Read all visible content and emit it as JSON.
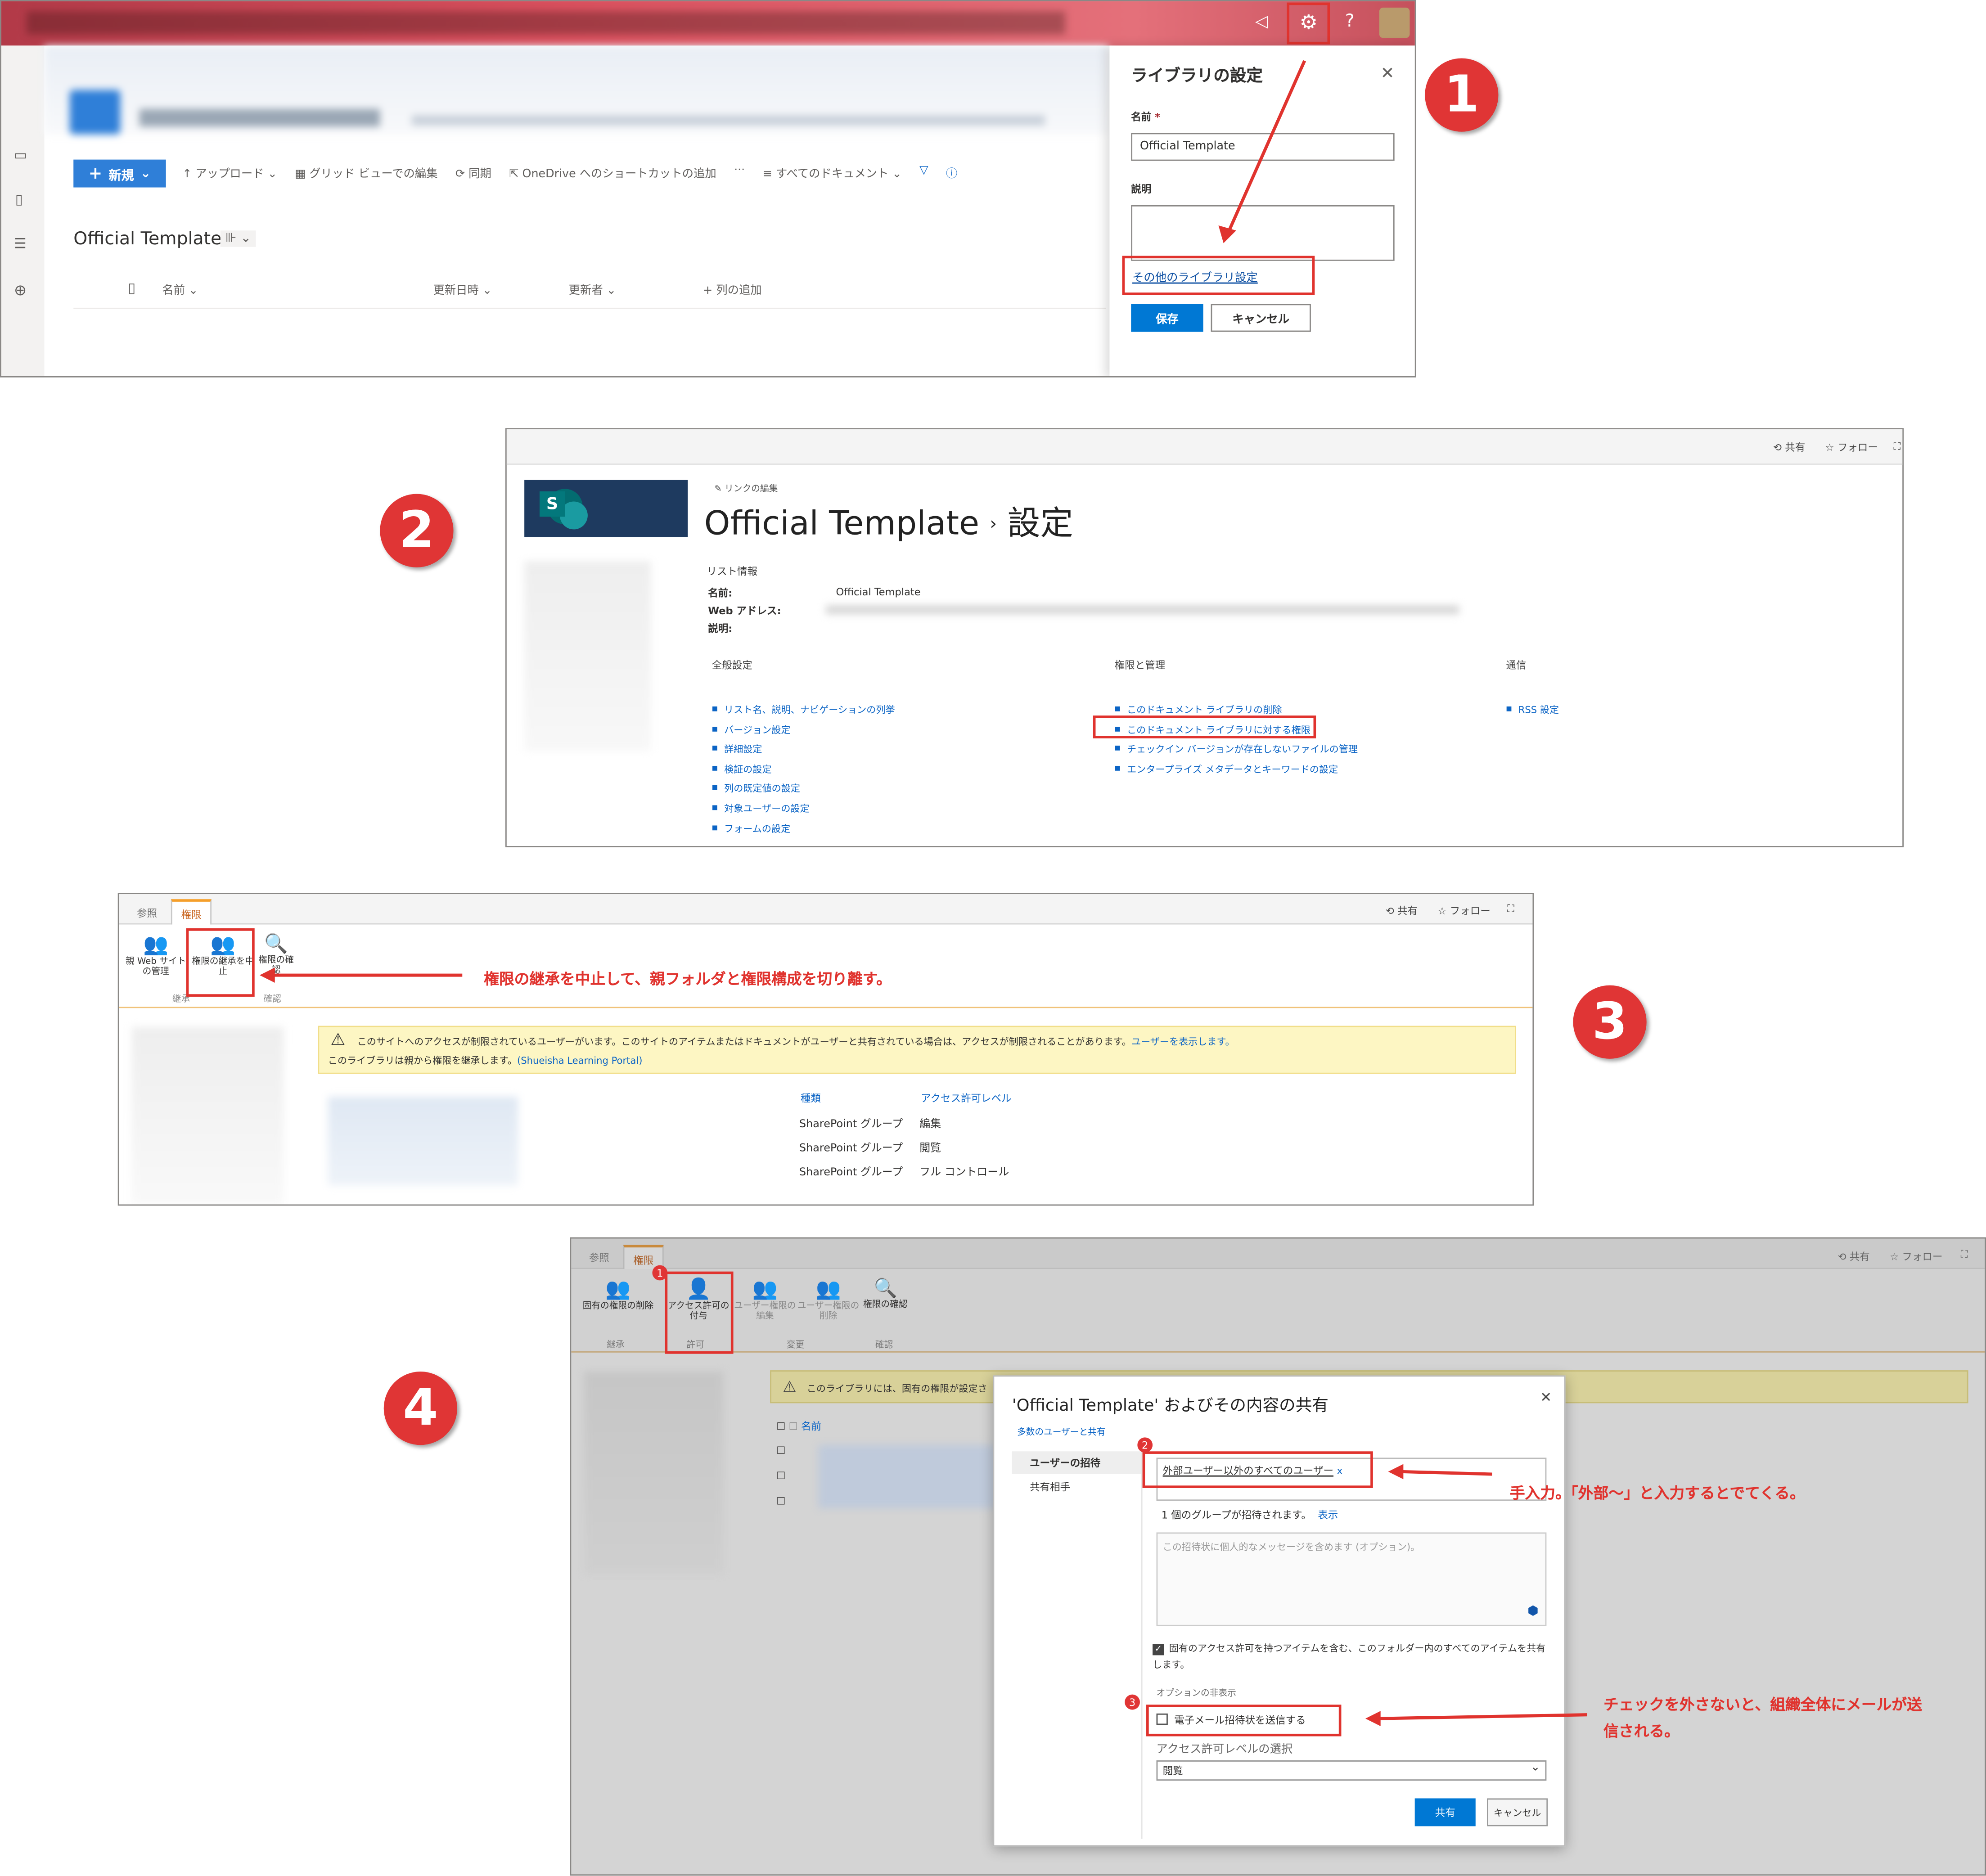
{
  "p1": {
    "commands": {
      "new": "新規",
      "upload": "アップロード",
      "grid_edit": "グリッド ビューでの編集",
      "sync": "同期",
      "onedrive": "OneDrive へのショートカットの追加",
      "more": "···",
      "all_docs": "すべてのドキュメント"
    },
    "library_title": "Official Template",
    "columns": {
      "name": "名前",
      "modified": "更新日時",
      "modified_by": "更新者",
      "add_column": "列の追加"
    },
    "settings_panel": {
      "title": "ライブラリの設定",
      "name_label": "名前",
      "required_mark": "*",
      "name_value": "Official Template",
      "desc_label": "説明",
      "more_settings_link": "その他のライブラリ設定",
      "save": "保存",
      "cancel": "キャンセル"
    }
  },
  "p2": {
    "share": "共有",
    "follow": "フォロー",
    "edit_links": "リンクの編集",
    "logo_letter": "S",
    "title": "Official Template",
    "title_sep": "›",
    "title_page": "設定",
    "list_info": "リスト情報",
    "info_name_label": "名前:",
    "info_name_value": "Official Template",
    "info_web_label": "Web アドレス:",
    "info_desc_label": "説明:",
    "col_general": "全般設定",
    "col_perm": "権限と管理",
    "col_comm": "通信",
    "general_links": [
      "リスト名、説明、ナビゲーションの列挙",
      "バージョン設定",
      "詳細設定",
      "検証の設定",
      "列の既定値の設定",
      "対象ユーザーの設定",
      "フォームの設定"
    ],
    "perm_links": [
      "このドキュメント ライブラリの削除",
      "このドキュメント ライブラリに対する権限",
      "チェックイン バージョンが存在しないファイルの管理",
      "エンタープライズ メタデータとキーワードの設定"
    ],
    "comm_links": [
      "RSS 設定"
    ]
  },
  "p3": {
    "tab_browse": "参照",
    "tab_perm": "権限",
    "share": "共有",
    "follow": "フォロー",
    "btn_parent": "親 Web サイトの管理",
    "btn_stop": "権限の継承を中止",
    "btn_check": "権限の確認",
    "group_inherit": "継承",
    "group_check": "確認",
    "note": "権限の継承を中止して、親フォルダと権限構成を切り離す。",
    "warning": "このサイトへのアクセスが制限されているユーザーがいます。このサイトのアイテムまたはドキュメントがユーザーと共有されている場合は、アクセスが制限されることがあります。",
    "warning_link": "ユーザーを表示します。",
    "inherit_text": "このライブラリは親から権限を継承します。",
    "inherit_link": "(Shueisha Learning Portal)",
    "col_type": "種類",
    "col_level": "アクセス許可レベル",
    "rows": [
      {
        "type": "SharePoint グループ",
        "level": "編集"
      },
      {
        "type": "SharePoint グループ",
        "level": "閲覧"
      },
      {
        "type": "SharePoint グループ",
        "level": "フル コントロール"
      }
    ]
  },
  "p4": {
    "tab_browse": "参照",
    "tab_perm": "権限",
    "share": "共有",
    "follow": "フォロー",
    "btn_delete_unique": "固有の権限の削除",
    "btn_grant": "アクセス許可の付与",
    "btn_edit_user": "ユーザー権限の編集",
    "btn_remove_user": "ユーザー権限の削除",
    "btn_check": "権限の確認",
    "group_inherit": "継承",
    "group_grant": "許可",
    "group_modify": "変更",
    "group_check": "確認",
    "warning": "このライブラリには、固有の権限が設定さ",
    "col_name": "名前",
    "dialog": {
      "title": "'Official Template' およびその内容の共有",
      "many_users": "多数のユーザーと共有",
      "nav_invite": "ユーザーの招待",
      "nav_shared": "共有相手",
      "chip": "外部ユーザー以外のすべてのユーザー",
      "chip_x": "x",
      "invited_count": "1 個のグループが招待されます。",
      "show": "表示",
      "message_placeholder": "この招待状に個人的なメッセージを含めます (オプション)。",
      "share_all": "固有のアクセス許可を持つアイテムを含む、このフォルダー内のすべてのアイテムを共有します。",
      "hide_options": "オプションの非表示",
      "send_email": "電子メール招待状を送信する",
      "level_label": "アクセス許可レベルの選択",
      "level_value": "閲覧",
      "share_btn": "共有",
      "cancel_btn": "キャンセル"
    },
    "note1": "手入力。「外部～」と入力するとでてくる。",
    "note2": "チェックを外さないと、組織全体にメールが送信される。"
  },
  "badges": [
    "1",
    "2",
    "3",
    "4"
  ],
  "mini_badges": [
    "1",
    "2",
    "3"
  ],
  "colors": {
    "accent": "#0078d4",
    "annotation_red": "#e0332e",
    "warning_bg": "#fdf6c3",
    "ribbon_tab": "#f59f2b"
  }
}
